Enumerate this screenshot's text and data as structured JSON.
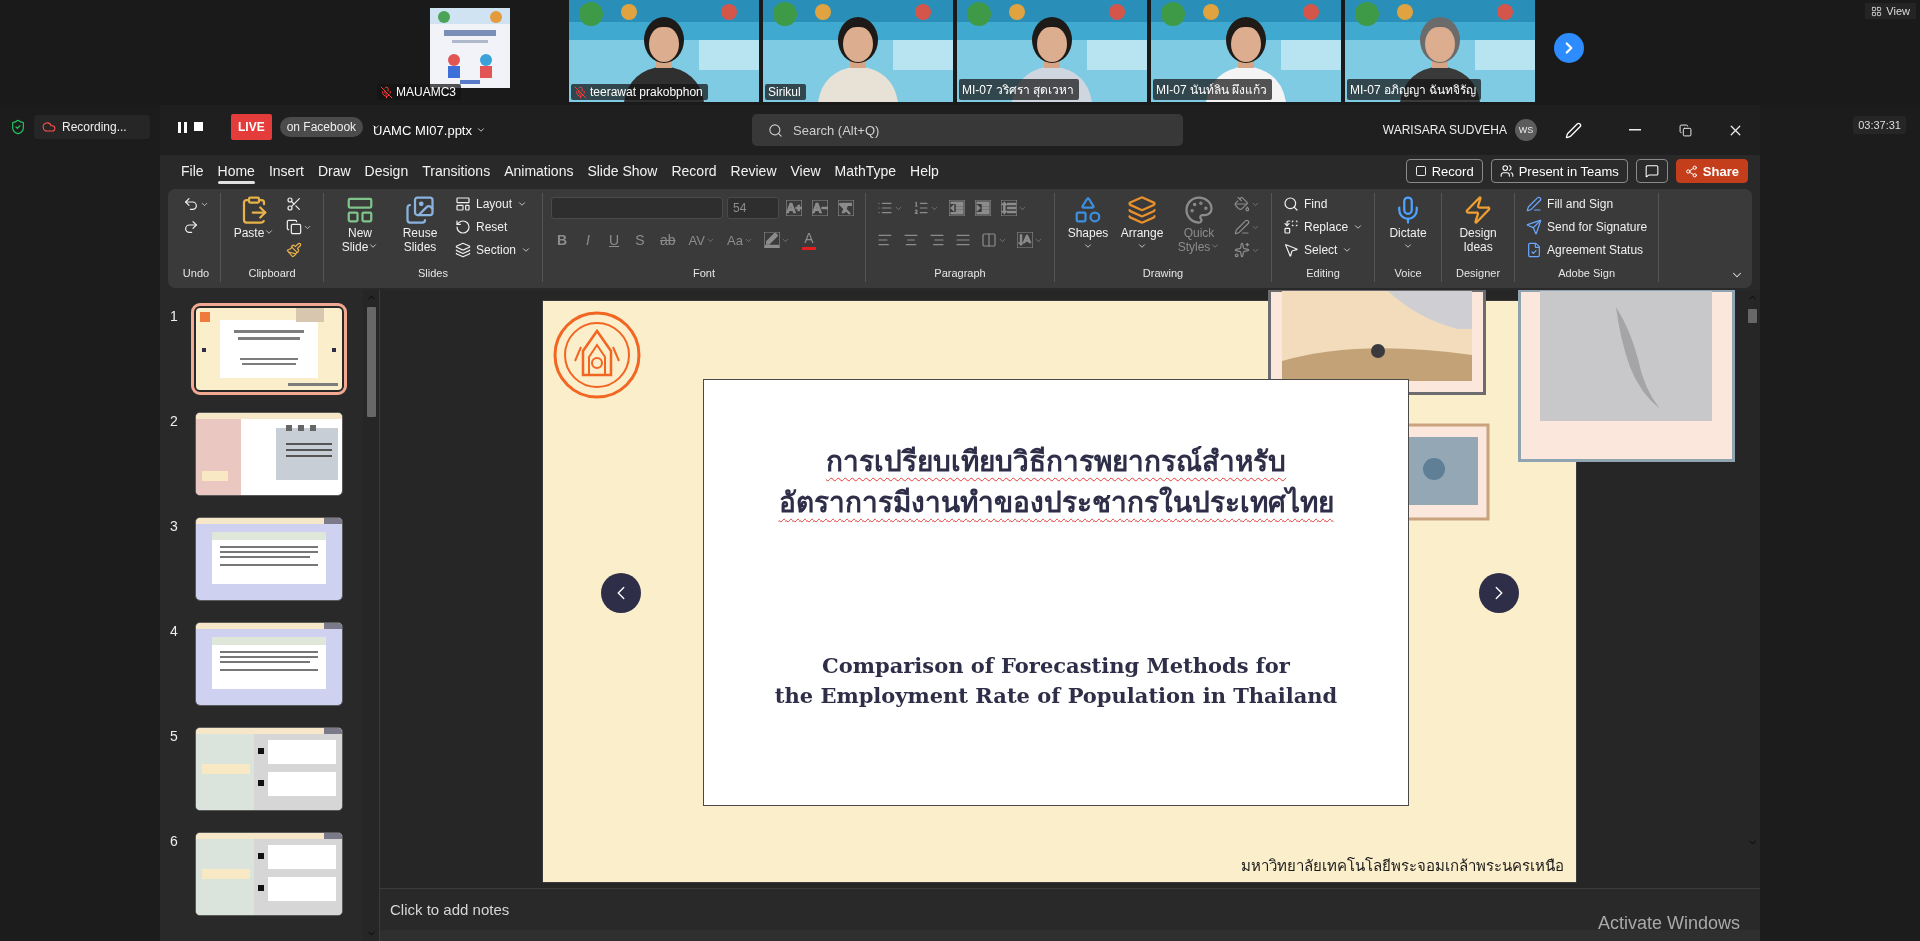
{
  "meeting": {
    "tiles": [
      {
        "kind": "poster",
        "name": "MAUAMC3",
        "muted": true
      },
      {
        "kind": "video",
        "name": "teerawat prakobphon",
        "muted": true
      },
      {
        "kind": "video",
        "name": "Sirikul",
        "muted": false
      },
      {
        "kind": "video",
        "name": "MI-07 วริศรา สุดเวหา",
        "muted": false
      },
      {
        "kind": "video",
        "name": "MI-07 นันท์ลิน ผึงแก้ว",
        "muted": false
      },
      {
        "kind": "video",
        "name": "MI-07 อภิญญา ฉันทจิรัญ",
        "muted": false
      }
    ],
    "view_button": "View",
    "clock": "03:37:31",
    "recording": "Recording...",
    "live_badge": "LIVE",
    "live_target": "on Facebook"
  },
  "window": {
    "file_name": "UAMC MI07.pptx",
    "search": {
      "placeholder": "Search (Alt+Q)"
    },
    "user": "WARISARA SUDVEHA",
    "avatar": "WS"
  },
  "menu": [
    {
      "label": "File",
      "selected": false
    },
    {
      "label": "Home",
      "selected": true
    },
    {
      "label": "Insert",
      "selected": false
    },
    {
      "label": "Draw",
      "selected": false
    },
    {
      "label": "Design",
      "selected": false
    },
    {
      "label": "Transitions",
      "selected": false
    },
    {
      "label": "Animations",
      "selected": false
    },
    {
      "label": "Slide Show",
      "selected": false
    },
    {
      "label": "Record",
      "selected": false
    },
    {
      "label": "Review",
      "selected": false
    },
    {
      "label": "View",
      "selected": false
    },
    {
      "label": "MathType",
      "selected": false
    },
    {
      "label": "Help",
      "selected": false
    }
  ],
  "menu_actions": [
    {
      "kind": "record",
      "label": "Record"
    },
    {
      "kind": "teams",
      "label": "Present in Teams"
    },
    {
      "kind": "comments"
    },
    {
      "kind": "share",
      "label": "Share"
    }
  ],
  "ribbon": [
    {
      "label": "Undo",
      "columns": [
        [
          {
            "kind": "icon-menu",
            "disabled": false
          },
          {
            "kind": "icon",
            "disabled": false
          }
        ]
      ]
    },
    {
      "label": "Clipboard",
      "columns": [
        [
          {
            "kind": "large-menu",
            "label": "Paste",
            "disabled": false
          }
        ],
        [
          {
            "kind": "icon",
            "disabled": false
          },
          {
            "kind": "icon-menu",
            "disabled": false
          },
          {
            "kind": "icon",
            "disabled": false
          }
        ]
      ]
    },
    {
      "label": "Slides",
      "columns": [
        [
          {
            "kind": "large-menu",
            "label": "New Slide",
            "disabled": false
          }
        ],
        [
          {
            "kind": "large",
            "label": "Reuse Slides",
            "disabled": false
          }
        ],
        [
          {
            "kind": "small-menu",
            "label": "Layout",
            "disabled": false
          },
          {
            "kind": "small",
            "label": "Reset",
            "disabled": false
          },
          {
            "kind": "small-menu",
            "label": "Section",
            "disabled": false
          }
        ]
      ]
    },
    {
      "label": "Font",
      "rows": [
        {
          "items": [
            {
              "kind": "field",
              "disabled": true
            },
            {
              "kind": "field",
              "value": "54",
              "disabled": true
            },
            {
              "kind": "icon",
              "disabled": true
            },
            {
              "kind": "icon",
              "disabled": true
            },
            {
              "kind": "icon",
              "disabled": true
            }
          ]
        },
        {
          "items": [
            {
              "kind": "glyph-bold",
              "label": "B",
              "disabled": true
            },
            {
              "kind": "glyph-italic",
              "label": "I",
              "disabled": true
            },
            {
              "kind": "glyph-underline",
              "label": "U",
              "disabled": true
            },
            {
              "kind": "glyph",
              "label": "S",
              "disabled": true
            },
            {
              "kind": "glyph-strike",
              "label": "ab",
              "disabled": true
            },
            {
              "kind": "glyph-menu",
              "label": "AV",
              "disabled": true
            },
            {
              "kind": "glyph-menu",
              "label": "Aa",
              "disabled": true
            },
            {
              "kind": "icon-menu",
              "disabled": true
            },
            {
              "kind": "color-glyph",
              "label": "A",
              "disabled": true
            }
          ]
        }
      ]
    },
    {
      "label": "Paragraph",
      "rows": [
        {
          "items": [
            {
              "kind": "icon-menu",
              "disabled": true
            },
            {
              "kind": "icon-menu",
              "disabled": true
            },
            {
              "kind": "icon",
              "disabled": true
            },
            {
              "kind": "icon",
              "disabled": true
            },
            {
              "kind": "icon-menu",
              "disabled": true
            }
          ]
        },
        {
          "items": [
            {
              "kind": "icon",
              "disabled": true
            },
            {
              "kind": "icon",
              "disabled": true
            },
            {
              "kind": "icon",
              "disabled": true
            },
            {
              "kind": "icon",
              "disabled": true
            },
            {
              "kind": "icon-menu",
              "disabled": true
            },
            {
              "kind": "icon-menu",
              "disabled": true
            }
          ]
        }
      ]
    },
    {
      "label": "Drawing",
      "columns": [
        [
          {
            "kind": "large-menu",
            "label": "Shapes",
            "disabled": false
          }
        ],
        [
          {
            "kind": "large-menu",
            "label": "Arrange",
            "disabled": false
          }
        ],
        [
          {
            "kind": "large-menu",
            "label": "Quick Styles",
            "disabled": true
          }
        ],
        [
          {
            "kind": "icon-menu",
            "disabled": true
          },
          {
            "kind": "icon-menu",
            "disabled": true
          },
          {
            "kind": "icon-menu",
            "disabled": true
          }
        ]
      ]
    },
    {
      "label": "Editing",
      "columns": [
        [
          {
            "kind": "small",
            "label": "Find",
            "disabled": false
          },
          {
            "kind": "small-menu",
            "label": "Replace",
            "disabled": false
          },
          {
            "kind": "small-menu",
            "label": "Select",
            "disabled": false
          }
        ]
      ]
    },
    {
      "label": "Voice",
      "columns": [
        [
          {
            "kind": "large-menu",
            "label": "Dictate",
            "disabled": false
          }
        ]
      ]
    },
    {
      "label": "Designer",
      "columns": [
        [
          {
            "kind": "large",
            "label": "Design Ideas",
            "disabled": false
          }
        ]
      ]
    },
    {
      "label": "Adobe Sign",
      "columns": [
        [
          {
            "kind": "small",
            "label": "Fill and Sign",
            "disabled": false
          },
          {
            "kind": "small",
            "label": "Send for Signature",
            "disabled": false
          },
          {
            "kind": "small",
            "label": "Agreement Status",
            "disabled": false
          }
        ]
      ]
    }
  ],
  "slides": [
    {
      "number": "1",
      "kind": "cover",
      "selected": true
    },
    {
      "number": "2",
      "kind": "gallery",
      "selected": false
    },
    {
      "number": "3",
      "kind": "text",
      "selected": false
    },
    {
      "number": "4",
      "kind": "text",
      "selected": false
    },
    {
      "number": "5",
      "kind": "steps",
      "selected": false
    },
    {
      "number": "6",
      "kind": "steps",
      "selected": false
    }
  ],
  "slide": {
    "title_lines": [
      "การเปรียบเทียบวิธีการพยากรณ์สำหรับ",
      "อัตราการมีงานทำของประชากรในประเทศไทย"
    ],
    "subtitle_lines": [
      "Comparison of Forecasting Methods for",
      "the Employment Rate of Population in Thailand"
    ],
    "footer": "มหาวิทยาลัยเทคโนโลยีพระจอมเกล้าพระนครเหนือ"
  },
  "notes": {
    "placeholder": "Click to add notes"
  },
  "system_notice": "Activate Windows"
}
